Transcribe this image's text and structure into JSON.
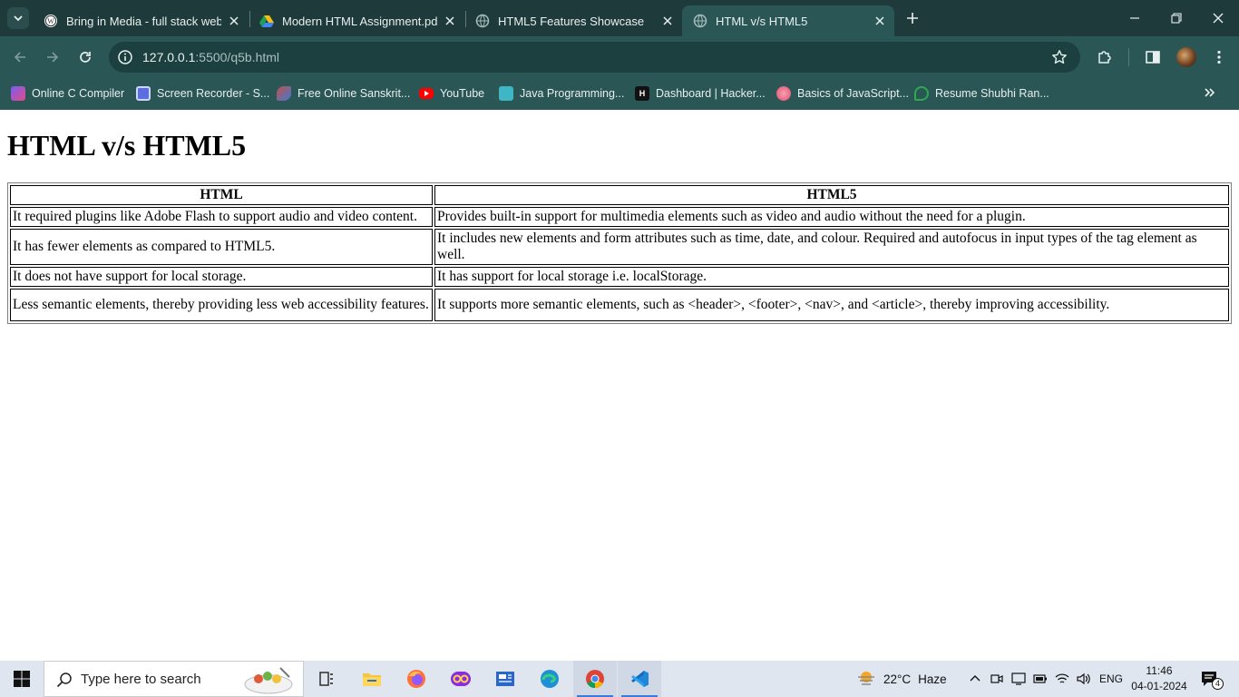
{
  "browser": {
    "tabs": [
      {
        "title": "Bring in Media - full stack web d",
        "favicon": "wordpress-icon"
      },
      {
        "title": "Modern HTML Assignment.pdf",
        "favicon": "google-drive-icon"
      },
      {
        "title": "HTML5 Features Showcase",
        "favicon": "globe-icon"
      },
      {
        "title": "HTML v/s HTML5",
        "favicon": "globe-icon",
        "active": true
      }
    ],
    "url_host": "127.0.0.1",
    "url_path": ":5500/q5b.html",
    "bookmarks": [
      {
        "label": "Online C Compiler",
        "icon": "compiler-icon",
        "color": "#7a5cf0"
      },
      {
        "label": "Screen Recorder - S...",
        "icon": "screen-recorder-icon",
        "color": "#5b6ee1"
      },
      {
        "label": "Free Online Sanskrit...",
        "icon": "sanskrit-icon",
        "color": "#c0504d"
      },
      {
        "label": "YouTube",
        "icon": "youtube-icon",
        "color": "#ff0000"
      },
      {
        "label": "Java Programming...",
        "icon": "java-icon",
        "color": "#3fb6c4"
      },
      {
        "label": "Dashboard | Hacker...",
        "icon": "hackerrank-icon",
        "color": "#111111"
      },
      {
        "label": "Basics of JavaScript...",
        "icon": "javascript-icon",
        "color": "#e04b6b"
      },
      {
        "label": "Resume Shubhi Ran...",
        "icon": "resume-icon",
        "color": "#2fa84f"
      }
    ],
    "accent": "#2a5656",
    "tabstrip_color": "#1e3a3a"
  },
  "page": {
    "heading": "HTML v/s HTML5",
    "table": {
      "headers": [
        "HTML",
        "HTML5"
      ],
      "rows": [
        [
          "It required plugins like Adobe Flash to support audio and video content.",
          "Provides built-in support for multimedia elements such as video and audio without the need for a plugin."
        ],
        [
          "It has fewer elements as compared to HTML5.",
          "It includes new elements and form attributes such as time, date, and colour. Required and autofocus in input types of the tag element as well."
        ],
        [
          "It does not have support for local storage.",
          "It has support for local storage i.e. localStorage."
        ],
        [
          "Less semantic elements, thereby providing less web accessibility features.",
          "It supports more semantic elements, such as <header>, <footer>, <nav>, and <article>, thereby improving accessibility."
        ]
      ]
    }
  },
  "taskbar": {
    "search_placeholder": "Type here to search",
    "weather_temp": "22°C",
    "weather_text": "Haze",
    "language": "ENG",
    "time": "11:46",
    "date": "04-01-2024",
    "notifications": "4",
    "apps": [
      "task-view-icon",
      "file-explorer-icon",
      "firefox-icon",
      "copilot-icon",
      "news-app-icon",
      "edge-icon",
      "chrome-icon",
      "vscode-icon"
    ]
  }
}
